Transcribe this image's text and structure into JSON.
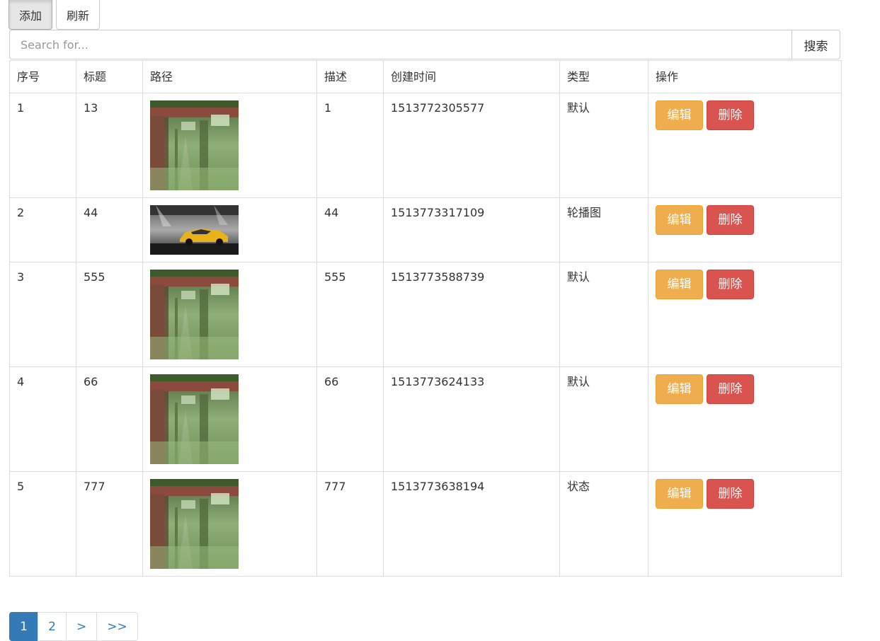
{
  "toolbar": {
    "add_label": "添加",
    "refresh_label": "刷新"
  },
  "search": {
    "placeholder": "Search for...",
    "button_label": "搜索"
  },
  "table": {
    "headers": [
      "序号",
      "标题",
      "路径",
      "描述",
      "创建时间",
      "类型",
      "操作"
    ],
    "rows": [
      {
        "id": "1",
        "title": "13",
        "image": "garden-gate-image",
        "desc": "1",
        "created": "1513772305577",
        "type": "默认"
      },
      {
        "id": "2",
        "title": "44",
        "image": "yellow-car-image",
        "desc": "44",
        "created": "1513773317109",
        "type": "轮播图"
      },
      {
        "id": "3",
        "title": "555",
        "image": "garden-gate-image",
        "desc": "555",
        "created": "1513773588739",
        "type": "默认"
      },
      {
        "id": "4",
        "title": "66",
        "image": "garden-gate-image",
        "desc": "66",
        "created": "1513773624133",
        "type": "默认"
      },
      {
        "id": "5",
        "title": "777",
        "image": "garden-gate-image",
        "desc": "777",
        "created": "1513773638194",
        "type": "状态"
      }
    ],
    "edit_label": "编辑",
    "delete_label": "删除"
  },
  "pagination": {
    "items": [
      "1",
      "2",
      ">",
      ">>"
    ],
    "active": "1"
  },
  "colors": {
    "primary": "#337ab7",
    "warning": "#f0ad4e",
    "danger": "#d9534f"
  }
}
